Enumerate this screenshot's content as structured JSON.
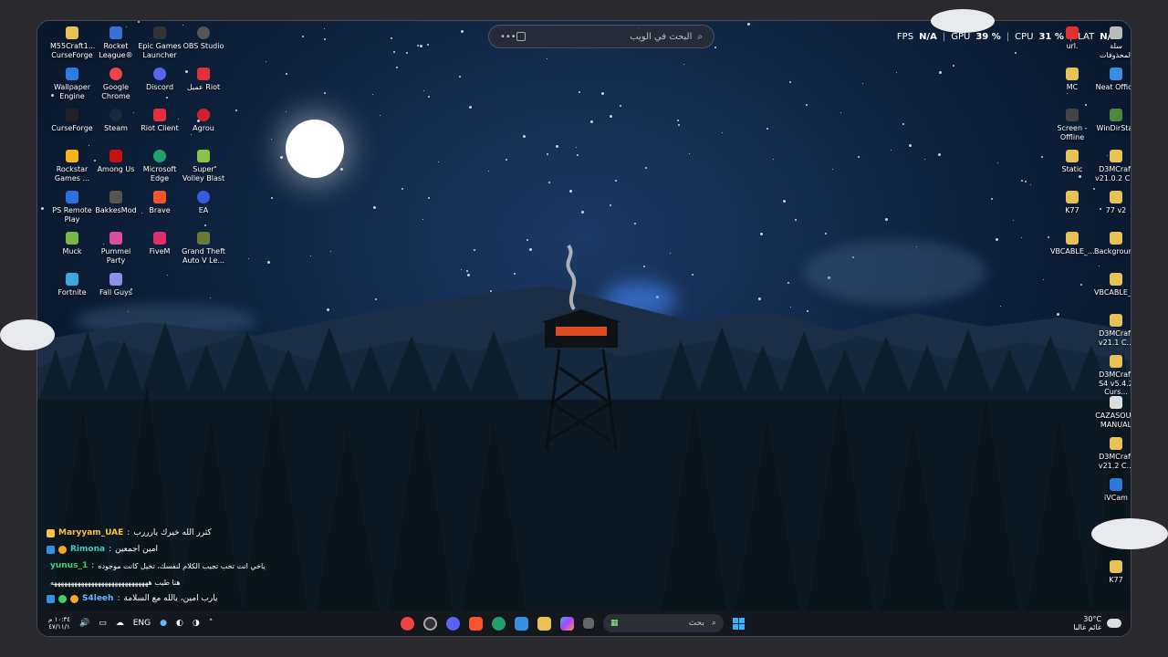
{
  "search": {
    "placeholder": "البحث في الويب",
    "more": "•••"
  },
  "overlay": {
    "fps_label": "FPS",
    "fps_value": "N/A",
    "gpu_label": "GPU",
    "gpu_value": "39 %",
    "cpu_label": "CPU",
    "cpu_value": "31 %",
    "lat_label": "LAT",
    "lat_value": "N/A"
  },
  "desktop_left": [
    {
      "label": "M55Craft1... CurseForge"
    },
    {
      "label": "Rocket League®"
    },
    {
      "label": "Epic Games Launcher"
    },
    {
      "label": "OBS Studio"
    },
    {
      "label": "Wallpaper Engine"
    },
    {
      "label": "Google Chrome"
    },
    {
      "label": "Discord"
    },
    {
      "label": "عميل Riot"
    },
    {
      "label": "CurseForge"
    },
    {
      "label": "Steam"
    },
    {
      "label": "Riot Client"
    },
    {
      "label": "Agrou"
    },
    {
      "label": "Rockstar Games ..."
    },
    {
      "label": "Among Us"
    },
    {
      "label": "Microsoft Edge"
    },
    {
      "label": "Super Volley Blast"
    },
    {
      "label": "PS Remote Play"
    },
    {
      "label": "BakkesMod"
    },
    {
      "label": "Brave"
    },
    {
      "label": "EA"
    },
    {
      "label": "Muck"
    },
    {
      "label": "Pummel Party"
    },
    {
      "label": "FiveM"
    },
    {
      "label": "Grand Theft Auto V Le..."
    },
    {
      "label": "Fortnite"
    },
    {
      "label": "Fall Guys"
    }
  ],
  "desktop_right": [
    {
      "label": "سلة المحذوفات"
    },
    {
      "label": "url."
    },
    {
      "label": "Neat Office"
    },
    {
      "label": "MC"
    },
    {
      "label": "WinDirStat"
    },
    {
      "label": "Screen - Offline"
    },
    {
      "label": "D3MCraft v21.0.2 C..."
    },
    {
      "label": "Static"
    },
    {
      "label": "77 v2"
    },
    {
      "label": "K77"
    },
    {
      "label": "Backgrounds"
    },
    {
      "label": "VBCABLE_..."
    },
    {
      "label": "VBCABLE_..."
    },
    {
      "label": "D3MCraft v21.1 C..."
    },
    {
      "label": "D3MCraft S4 v5.4.2 Curs..."
    },
    {
      "label": "CAZASOUQ MANUAL"
    },
    {
      "label": "D3MCraft v21.2 C..."
    },
    {
      "label": "iVCam"
    },
    {
      "label": "K77"
    }
  ],
  "chat": [
    {
      "user": "Maryyam_UAE",
      "sep": ":",
      "message": "كثرر الله خيرك يارررب",
      "color": "#f5c542"
    },
    {
      "user": "Rimona",
      "sep": ":",
      "message": "امين اجمعين",
      "color": "#3fd0c5"
    },
    {
      "user": "yunus_1",
      "sep": ":",
      "message": "ياخي انت تحب تجيب الكلام لنفسك، تخيل كانت موجوده",
      "color": "#3fd06a"
    },
    {
      "user": "",
      "sep": "",
      "message": "هنا طيب هههههههههههههههههههههههههههههه",
      "color": "#ffffff"
    },
    {
      "user": "S4leeh",
      "sep": ":",
      "message": "يارب امين، يالله مع السلامة",
      "color": "#6fb4ff"
    }
  ],
  "taskbar": {
    "lang": "ENG",
    "search_placeholder": "بحث",
    "time": "١٠:٣٤ م",
    "date": "٤٧/١١/١",
    "weather_temp": "30°C",
    "weather_desc": "غائم غالبا"
  },
  "colors": {
    "accent": "#4a90ff",
    "taskbar": "#16181e"
  }
}
